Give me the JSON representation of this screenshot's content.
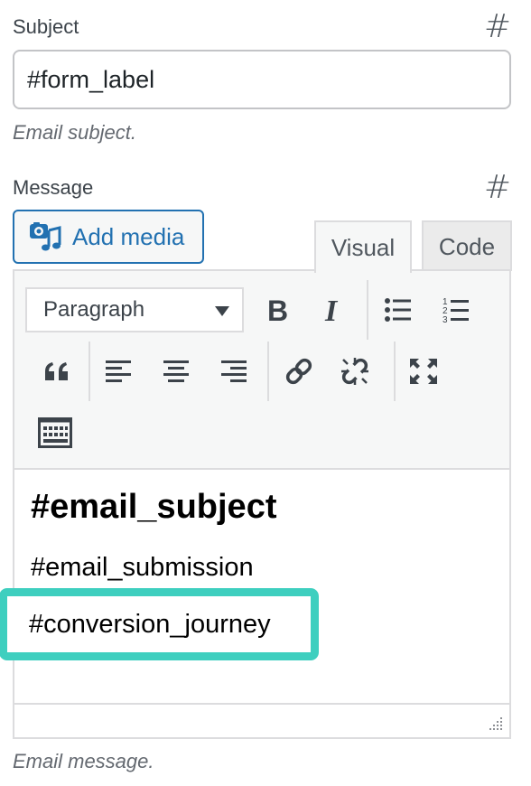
{
  "subject": {
    "label": "Subject",
    "hash_icon": "hash-icon",
    "value": "#form_label",
    "description": "Email subject."
  },
  "message": {
    "label": "Message",
    "hash_icon": "hash-icon",
    "add_media_label": "Add media",
    "tabs": [
      {
        "label": "Visual",
        "active": true
      },
      {
        "label": "Code",
        "active": false
      }
    ],
    "toolbar": {
      "format_value": "Paragraph",
      "buttons": [
        "bold",
        "italic",
        "bulleted-list",
        "numbered-list",
        "blockquote",
        "align-left",
        "align-center",
        "align-right",
        "insert-link",
        "remove-link",
        "fullscreen",
        "toolbar-toggle"
      ]
    },
    "content": {
      "heading": "#email_subject",
      "line1": "#email_submission",
      "line2": "#conversion_journey"
    },
    "description": "Email message."
  },
  "colors": {
    "accent": "#2271b1",
    "highlight": "#3ecfbf"
  }
}
